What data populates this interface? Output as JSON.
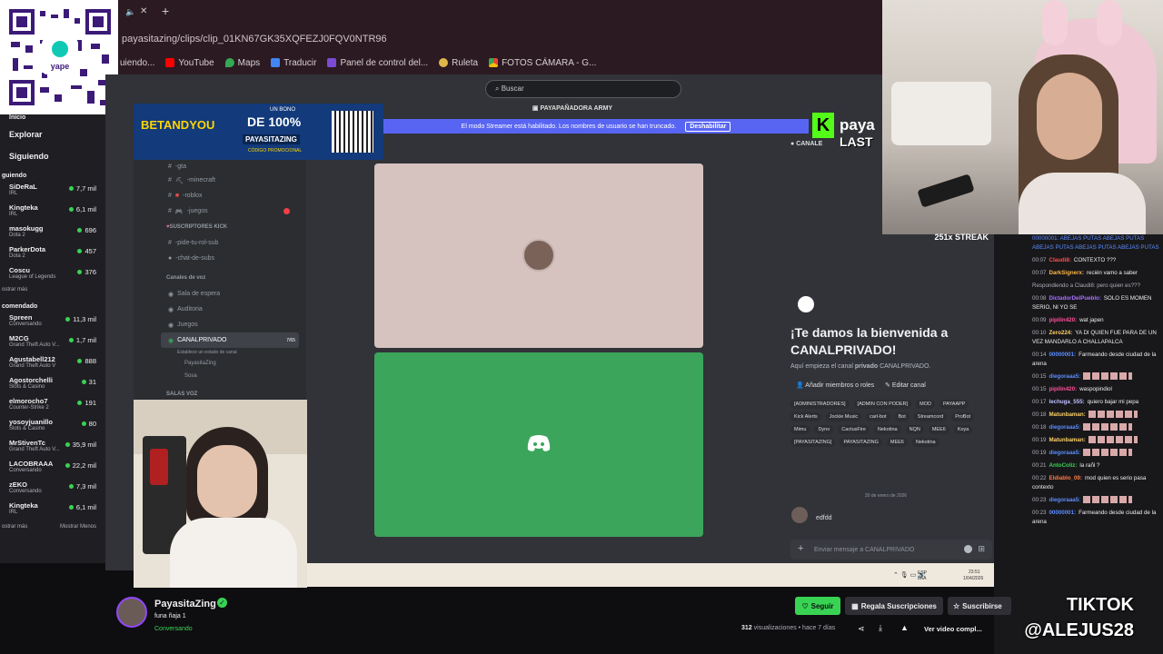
{
  "browser": {
    "url": "payasitazing/clips/clip_01KN67GK35XQFEZJ0FQV0NTR96",
    "bookmarks": [
      "uiendo...",
      "YouTube",
      "Maps",
      "Traducir",
      "Panel de control del...",
      "Ruleta",
      "FOTOS CÁMARA - G..."
    ]
  },
  "qr": {
    "brand": "yape"
  },
  "leftnav": {
    "main_items": [
      "Inicio",
      "Explorar",
      "Siguiendo"
    ],
    "following_title": "guiendo",
    "following": [
      {
        "name": "SiDeRaL",
        "game": "IRL",
        "viewers": "7,7 mil"
      },
      {
        "name": "Kingteka",
        "game": "IRL",
        "viewers": "6,1 mil"
      },
      {
        "name": "masokugg",
        "game": "Dota 2",
        "viewers": "696"
      },
      {
        "name": "ParkerDota",
        "game": "Dota 2",
        "viewers": "457"
      },
      {
        "name": "Coscu",
        "game": "League of Legends",
        "viewers": "376"
      }
    ],
    "show_more_1": "ostrar más",
    "recommended_title": "comendado",
    "recommended": [
      {
        "name": "Spreen",
        "game": "Conversando",
        "viewers": "11,3 mil"
      },
      {
        "name": "M2CG",
        "game": "Grand Theft Auto V...",
        "viewers": "1,7 mil"
      },
      {
        "name": "Agustabell212",
        "game": "Grand Theft Auto V",
        "viewers": "888"
      },
      {
        "name": "Agostorchelli",
        "game": "Slots & Casino",
        "viewers": "31"
      },
      {
        "name": "elmorocho7",
        "game": "Counter-Strike 2",
        "viewers": "191"
      },
      {
        "name": "yosoyjuanillo",
        "game": "Slots & Casino",
        "viewers": "80"
      },
      {
        "name": "MrStivenTc",
        "game": "Grand Theft Auto V...",
        "viewers": "35,9 mil"
      },
      {
        "name": "LACOBRAAA",
        "game": "Conversando",
        "viewers": "22,2 mil"
      },
      {
        "name": "zEKO",
        "game": "Conversando",
        "viewers": "7,3 mil"
      },
      {
        "name": "Kingteka",
        "game": "IRL",
        "viewers": "6,1 mil"
      }
    ],
    "show_more_2": "ostrar más",
    "show_less": "Mostrar Menos"
  },
  "ad": {
    "brand": "BETANDYOU",
    "bonus": "DE 100%",
    "code": "PAYASITAZING",
    "sub": "CÓDIGO PROMOCIONAL",
    "tag": "UN BONO"
  },
  "discord": {
    "search_placeholder": "Buscar",
    "server_name": "PAYAPAÑADORA ARMY",
    "streamer_notice": "El modo Streamer está habilitado. Los nombres de usuario se han truncado.",
    "streamer_disable": "Deshabilitar",
    "channels": [
      {
        "label": "-minecraft",
        "emoji": "⛏"
      },
      {
        "label": "-roblox",
        "emoji": "■"
      },
      {
        "label": "-juegos",
        "emoji": "🎮"
      }
    ],
    "cat_subs": "SUSCRIPTORES KICK",
    "sub_channels": [
      "-pide-tu-rol-sub",
      "-chat-de-subs"
    ],
    "cat_voice": "Canales de voz",
    "voice_channels": [
      "Sala de espera",
      "Auditoria",
      "Juegos"
    ],
    "active_channel": "CANALPRIVADO",
    "active_count": "7/65",
    "active_status": "Establece un estado de canal",
    "voice_users": [
      "PayasitaZing",
      "Sosa"
    ],
    "cat_voice2": "SALAS VOZ",
    "channel_header": "CANALE",
    "welcome": "¡Te damos la bienvenida a CANALPRIVADO!",
    "welcome_sub_pre": "Aquí empieza el canal",
    "welcome_sub_bold": "privado",
    "welcome_sub_post": "CANALPRIVADO.",
    "btn_add": "Añadir miembros o roles",
    "btn_edit": "Editar canal",
    "roles": [
      "[ADMINISTRADORES]",
      "[ADMIN CON PODER]",
      "MOD",
      "PAYAAPP",
      "Kick Alerts",
      "Jockie Music",
      "carl-bot",
      "Bot",
      "Streamcord",
      "ProBot",
      "Mimu",
      "Dyno",
      "CactusFire",
      "Nekotina",
      "NQN",
      "MEE6",
      "Koya",
      "[PAYASITAZING]",
      "PAYASITAZING",
      "MEE6",
      "Nekotina"
    ],
    "date_sep": "30 de enero de 2026",
    "msg_text": "edfdd",
    "input_placeholder": "Enviar mensaje a CANALPRIVADO",
    "taskbar": {
      "lang": "ESP LAA",
      "time": "23:51",
      "date": "1/04/2026"
    }
  },
  "overlay": {
    "streak": "251x STREAK",
    "kick_text": "paya",
    "last": "LAST"
  },
  "chat": [
    {
      "time": "",
      "user": "",
      "text": "00000001: ABEJAS PUTAS ABEJAS PUTAS ABEJAS PUTAS ABEJAS PUTAS ABEJAS PUTAS",
      "color": "#5b8cff"
    },
    {
      "time": "00:07",
      "user": "Claudi8:",
      "text": "CONTEXTO ???",
      "color": "#ff4f4f"
    },
    {
      "time": "00:07",
      "user": "DarkSignerx:",
      "text": "recién vamo a saber",
      "color": "#ffb545"
    },
    {
      "time": "",
      "user": "",
      "text": "Respondiendo a Claudi8: pero quien es???",
      "color": "#adadb8"
    },
    {
      "time": "00:08",
      "user": "DictadorDelPueblo:",
      "text": "SOLO ES MOMEN SERIO, NI YO SE",
      "color": "#a970ff"
    },
    {
      "time": "00:09",
      "user": "pipilin420:",
      "text": "wat japen",
      "color": "#ff4f9a"
    },
    {
      "time": "00:10",
      "user": "Zero224:",
      "text": "YA DI QUIEN FUE PARA DE UN VEZ MANDARLO A CHALLAPALCA",
      "color": "#ffd166"
    },
    {
      "time": "00:14",
      "user": "00000001:",
      "text": "Farmeando desde ciudad de la arena",
      "color": "#5b8cff"
    },
    {
      "time": "00:15",
      "user": "diegoraaa5:",
      "text": "",
      "color": "#5b8cff"
    },
    {
      "time": "00:15",
      "user": "pipilin420:",
      "text": "waspopindiol",
      "color": "#ff4f9a"
    },
    {
      "time": "00:17",
      "user": "lechuga_555:",
      "text": "quiero bajar mi pepa",
      "color": "#c0c0ff"
    },
    {
      "time": "00:18",
      "user": "Matunbaman:",
      "text": "",
      "color": "#ffd166"
    },
    {
      "time": "00:18",
      "user": "diegoraaa5:",
      "text": "",
      "color": "#5b8cff"
    },
    {
      "time": "00:19",
      "user": "Matunbaman:",
      "text": "",
      "color": "#ffd166"
    },
    {
      "time": "00:19",
      "user": "diegoraaa5:",
      "text": "",
      "color": "#5b8cff"
    },
    {
      "time": "00:21",
      "user": "AntoColiz:",
      "text": "la rañl ?",
      "color": "#39d353"
    },
    {
      "time": "00:22",
      "user": "Eldiablo_09:",
      "text": "mod quien es serio pasa contexto",
      "color": "#ff7a45"
    },
    {
      "time": "00:23",
      "user": "diegoraaa5:",
      "text": "",
      "color": "#5b8cff"
    },
    {
      "time": "00:23",
      "user": "00000001:",
      "text": "Farmeando desde ciudad de la arena",
      "color": "#5b8cff"
    }
  ],
  "info": {
    "channel": "PayasitaZing",
    "title": "funa ñaja 1",
    "category": "Conversando",
    "follow": "Seguir",
    "gift": "Regala Suscripciones",
    "subscribe": "Suscribirse",
    "views_count": "312",
    "views_text": "visualizaciones • hace 7 días",
    "full_video": "Ver video compl..."
  },
  "watermark": {
    "line1": "TIKTOK",
    "line2": "@ALEJUS28"
  },
  "colors": {
    "accent": "#39d353",
    "discord_blurple": "#5865f2",
    "discord_green": "#3ba55c"
  }
}
